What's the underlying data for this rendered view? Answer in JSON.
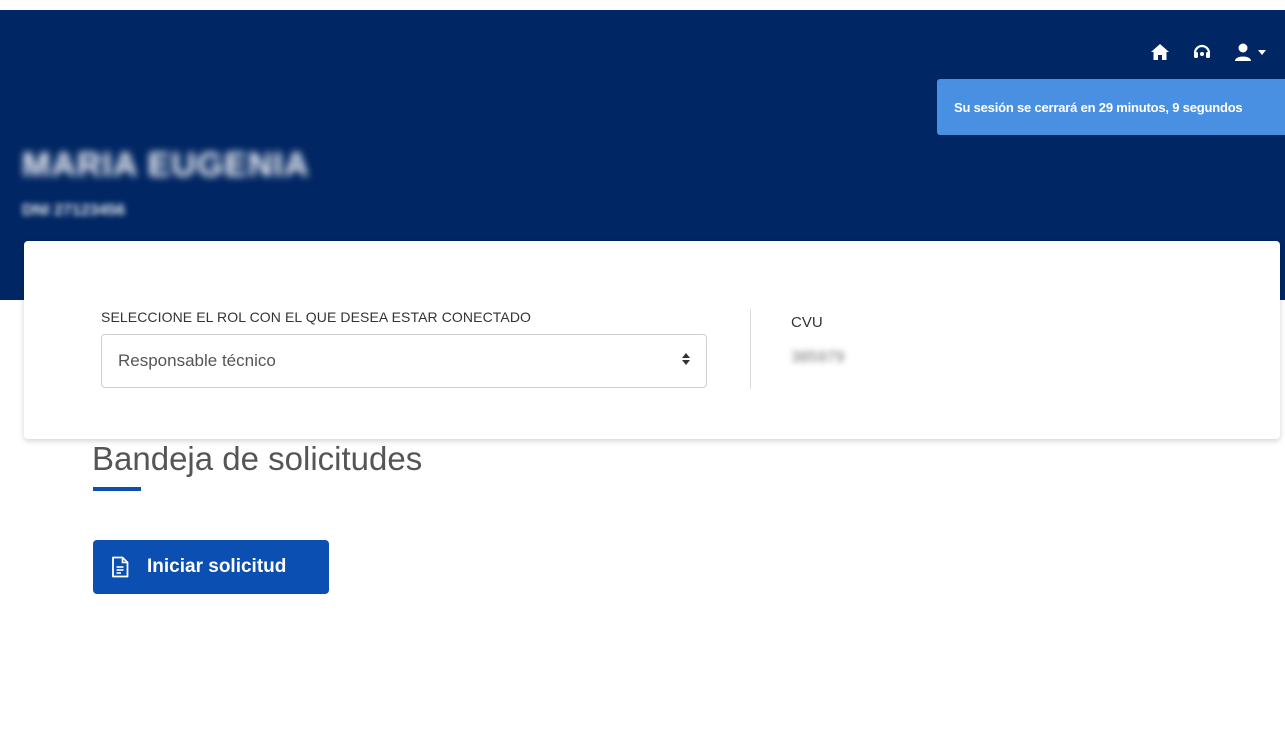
{
  "header": {
    "background_color": "#002663",
    "icons": [
      "home-icon",
      "headset-icon",
      "user-icon"
    ],
    "user": {
      "name": "MARIA EUGENIA",
      "subtitle": "DNI 27123456"
    }
  },
  "session_alert": {
    "text": "Su sesión se cerrará en 29 minutos, 9 segundos",
    "color": "#4a90e2"
  },
  "role_card": {
    "role_label": "SELECCIONE EL ROL CON EL QUE DESEA ESTAR CONECTADO",
    "role_selected": "Responsable técnico",
    "cvu_label": "CVU",
    "cvu_value": "385979"
  },
  "main": {
    "title": "Bandeja de solicitudes",
    "accent_color": "#0b4fb3",
    "start_button_label": "Iniciar solicitud",
    "start_button_icon": "document-icon"
  }
}
